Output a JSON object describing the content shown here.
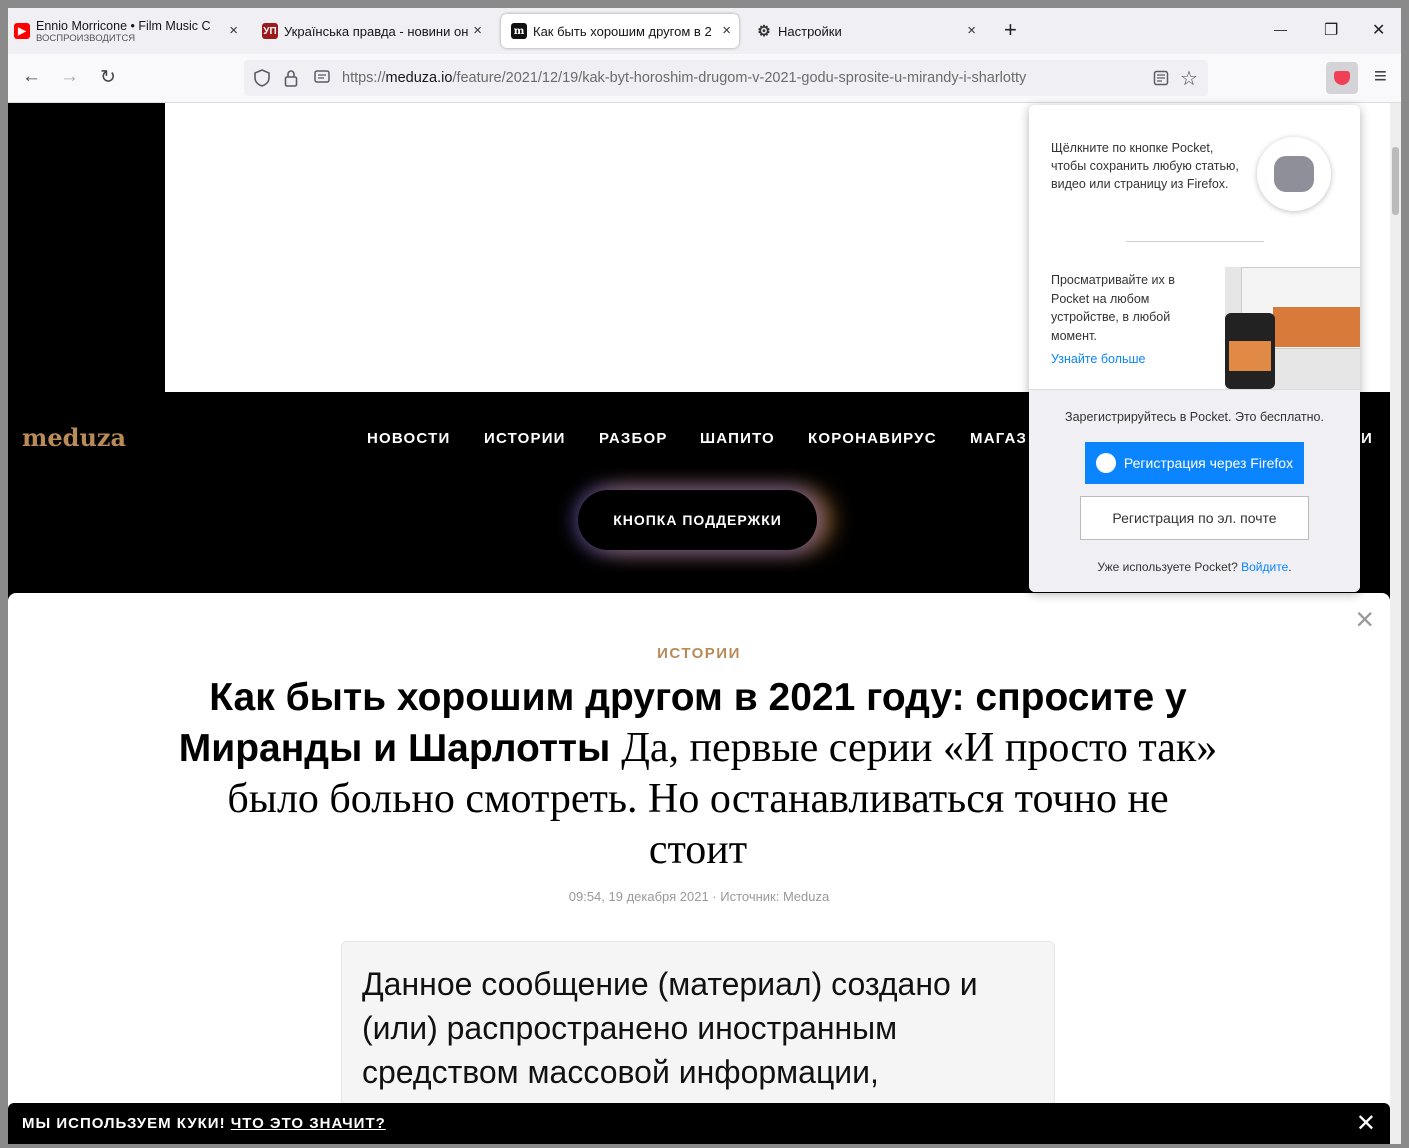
{
  "browser": {
    "tabs": [
      {
        "title": "Ennio Morricone • Film Music C",
        "subtitle": "ВОСПРОИЗВОДИТСЯ",
        "favicon": "youtube-icon",
        "close": "×"
      },
      {
        "title": "Українська правда - новини он",
        "favicon": "up-icon",
        "favicon_text": "УП",
        "close": "×"
      },
      {
        "title": "Как быть хорошим другом в 2",
        "favicon": "meduza-icon",
        "favicon_text": "m",
        "close": "×",
        "active": true
      },
      {
        "title": "Настройки",
        "favicon": "gear-icon",
        "close": "×"
      }
    ],
    "new_tab": "+",
    "window_controls": {
      "minimize": "—",
      "restore": "❐",
      "close": "✕"
    },
    "nav": {
      "back": "←",
      "forward": "→",
      "reload": "↻"
    },
    "url": {
      "prefix": "https://",
      "host": "meduza.io",
      "path": "/feature/2021/12/19/kak-byt-horoshim-drugom-v-2021-godu-sprosite-u-mirandy-i-sharlotty"
    },
    "menu_icon": "≡"
  },
  "site": {
    "logo": "meduza",
    "menu": [
      "НОВОСТИ",
      "ИСТОРИИ",
      "РАЗБОР",
      "ШАПИТО",
      "КОРОНАВИРУС",
      "МАГАЗ",
      "И"
    ],
    "support_button": "КНОПКА ПОДДЕРЖКИ"
  },
  "article": {
    "rubric": "ИСТОРИИ",
    "title": "Как быть хорошим другом в 2021 году: спросите у Миранды и Шарлотты",
    "subtitle": "Да, первые серии «И просто так» было больно смотреть. Но останавливаться точно не стоит",
    "meta": "09:54, 19 декабря 2021 · Источник: Meduza",
    "notice": "Данное сообщение (материал) создано и (или) распространено иностранным средством массовой информации,"
  },
  "cookie_bar": {
    "text": "МЫ ИСПОЛЬЗУЕМ КУКИ!",
    "link": "ЧТО ЭТО ЗНАЧИТ?",
    "close": "✕"
  },
  "pocket": {
    "intro": "Щёлкните по кнопке Pocket, чтобы сохранить любую статью, видео или страницу из Firefox.",
    "view": "Просматривайте их в Pocket на любом устройстве, в любой момент.",
    "learn_more": "Узнайте больше",
    "register_note": "Зарегистрируйтесь в Pocket. Это бесплатно.",
    "firefox_button": "Регистрация через Firefox",
    "email_button": "Регистрация по эл. почте",
    "already": "Уже используете Pocket?",
    "login": "Войдите",
    "colors": {
      "pocket_red": "#ef4056",
      "firefox_blue": "#0a84ff"
    }
  },
  "colors": {
    "meduza_gold": "#b88b58",
    "chrome_bg": "#f0f0f4"
  }
}
